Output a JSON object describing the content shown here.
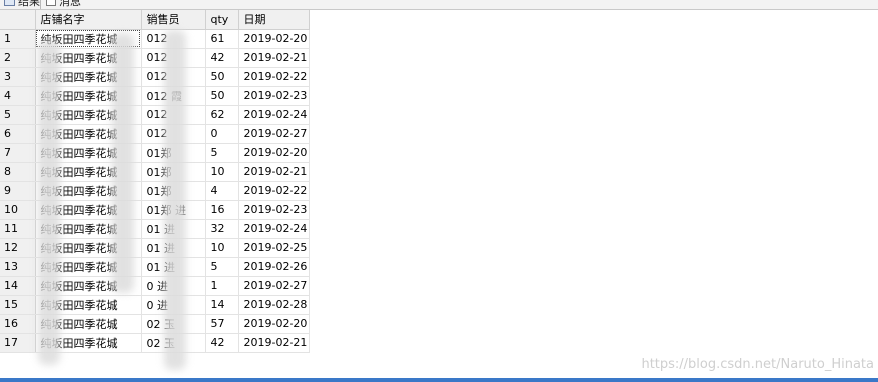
{
  "tabs": {
    "results": "结果",
    "messages": "消息"
  },
  "grid": {
    "columns": [
      "店铺名字",
      "销售员",
      "qty",
      "日期"
    ],
    "rows": [
      {
        "n": "1",
        "shop": "纯坂田四季花城",
        "seller": "012",
        "qty": "61",
        "date": "2019-02-20"
      },
      {
        "n": "2",
        "shop": "纯坂田四季花城",
        "seller": "012",
        "qty": "42",
        "date": "2019-02-21"
      },
      {
        "n": "3",
        "shop": "纯坂田四季花城",
        "seller": "012",
        "qty": "50",
        "date": "2019-02-22"
      },
      {
        "n": "4",
        "shop": "纯坂田四季花城",
        "seller": "012 霞",
        "qty": "50",
        "date": "2019-02-23"
      },
      {
        "n": "5",
        "shop": "纯坂田四季花城",
        "seller": "012",
        "qty": "62",
        "date": "2019-02-24"
      },
      {
        "n": "6",
        "shop": "纯坂田四季花城",
        "seller": "012",
        "qty": "0",
        "date": "2019-02-27"
      },
      {
        "n": "7",
        "shop": "纯坂田四季花城",
        "seller": "01郑",
        "qty": "5",
        "date": "2019-02-20"
      },
      {
        "n": "8",
        "shop": "纯坂田四季花城",
        "seller": "01郑",
        "qty": "10",
        "date": "2019-02-21"
      },
      {
        "n": "9",
        "shop": "纯坂田四季花城",
        "seller": "01郑",
        "qty": "4",
        "date": "2019-02-22"
      },
      {
        "n": "10",
        "shop": "纯坂田四季花城",
        "seller": "01郑 进",
        "qty": "16",
        "date": "2019-02-23"
      },
      {
        "n": "11",
        "shop": "纯坂田四季花城",
        "seller": "01 进",
        "qty": "32",
        "date": "2019-02-24"
      },
      {
        "n": "12",
        "shop": "纯坂田四季花城",
        "seller": "01 进",
        "qty": "10",
        "date": "2019-02-25"
      },
      {
        "n": "13",
        "shop": "纯坂田四季花城",
        "seller": "01 进",
        "qty": "5",
        "date": "2019-02-26"
      },
      {
        "n": "14",
        "shop": "纯坂田四季花城",
        "seller": "0 进",
        "qty": "1",
        "date": "2019-02-27"
      },
      {
        "n": "15",
        "shop": "纯坂田四季花城",
        "seller": "0 进",
        "qty": "14",
        "date": "2019-02-28"
      },
      {
        "n": "16",
        "shop": "纯坂田四季花城",
        "seller": "02 玉",
        "qty": "57",
        "date": "2019-02-20"
      },
      {
        "n": "17",
        "shop": "纯坂田四季花城",
        "seller": "02 玉",
        "qty": "42",
        "date": "2019-02-21"
      }
    ]
  },
  "watermark": "https://blog.csdn.net/Naruto_Hinata"
}
